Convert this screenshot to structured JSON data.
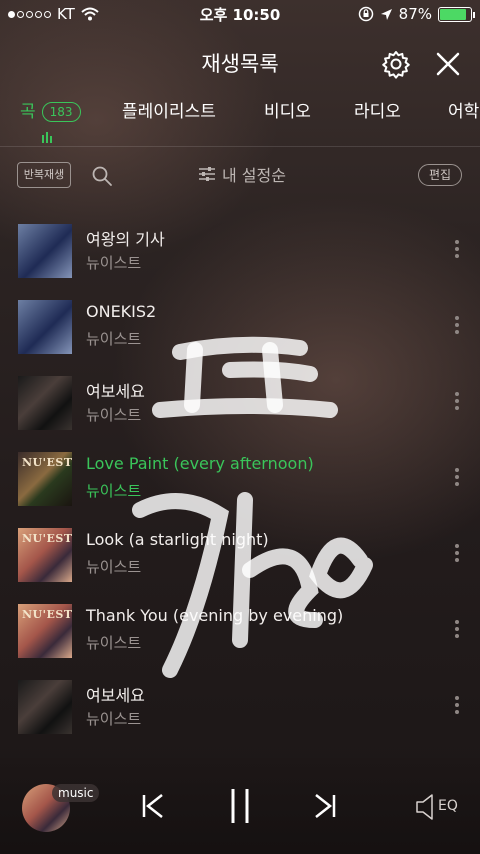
{
  "status_bar": {
    "carrier": "KT",
    "time": "오후 10:50",
    "battery_percent": "87%",
    "battery_level": 0.87
  },
  "header": {
    "title": "재생목록",
    "settings_icon": "gear-icon",
    "close_icon": "close-icon"
  },
  "tabs": [
    {
      "label": "곡",
      "count": "183",
      "active": true
    },
    {
      "label": "플레이리스트"
    },
    {
      "label": "비디오"
    },
    {
      "label": "라디오"
    },
    {
      "label": "어학"
    }
  ],
  "toolbar": {
    "repeat_label": "반복재생",
    "sort_label": "내 설정순",
    "edit_label": "편집"
  },
  "songs": [
    {
      "title": "여왕의 기사",
      "artist": "뉴이스트"
    },
    {
      "title": "ONEKIS2",
      "artist": "뉴이스트"
    },
    {
      "title": "여보세요",
      "artist": "뉴이스트"
    },
    {
      "title": "Love Paint (every afternoon)",
      "artist": "뉴이스트",
      "playing": true
    },
    {
      "title": "Look (a starlight night)",
      "artist": "뉴이스트"
    },
    {
      "title": "Thank You (evening by evening)",
      "artist": "뉴이스트"
    },
    {
      "title": "여보세요",
      "artist": "뉴이스트"
    }
  ],
  "album_art_text": {
    "nuest": "NU'EST"
  },
  "player": {
    "tag": "music",
    "eq_label": "EQ"
  },
  "colors": {
    "accent": "#3ac55a"
  }
}
